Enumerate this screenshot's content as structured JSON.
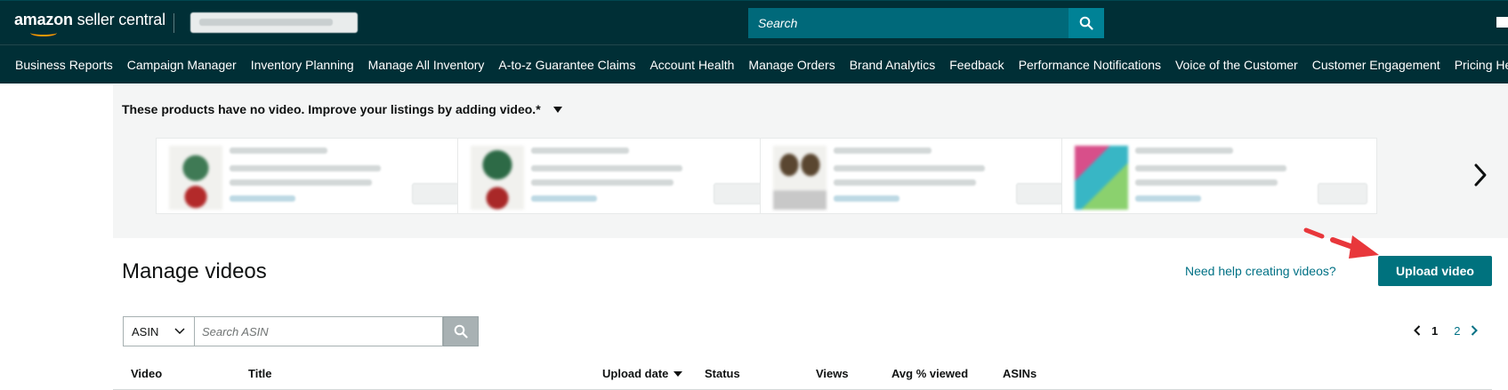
{
  "header": {
    "logo_text": "amazon",
    "logo_suffix": "seller central",
    "search_placeholder": "Search"
  },
  "nav": [
    "Business Reports",
    "Campaign Manager",
    "Inventory Planning",
    "Manage All Inventory",
    "A-to-z Guarantee Claims",
    "Account Health",
    "Manage Orders",
    "Brand Analytics",
    "Feedback",
    "Performance Notifications",
    "Voice of the Customer",
    "Customer Engagement",
    "Pricing Health"
  ],
  "banner": {
    "title": "These products have no video. Improve your listings by adding video.*"
  },
  "main": {
    "heading": "Manage videos",
    "help_link": "Need help creating videos?",
    "upload_button": "Upload video"
  },
  "filter": {
    "select_value": "ASIN",
    "search_placeholder": "Search ASIN"
  },
  "pagination": {
    "pages": [
      "1",
      "2"
    ],
    "current": "1"
  },
  "table": {
    "columns": [
      "Video",
      "Title",
      "Upload date",
      "Status",
      "Views",
      "Avg % viewed",
      "ASINs"
    ]
  },
  "colors": {
    "header_bg": "#002f36",
    "search_bg": "#00697a",
    "accent": "#00727e",
    "link": "#007185",
    "annotation_arrow": "#e8373b"
  },
  "icons": {
    "search": "magnifier-icon",
    "mail": "mail-icon",
    "next": "chevron-right-icon",
    "prev": "chevron-left-icon"
  }
}
